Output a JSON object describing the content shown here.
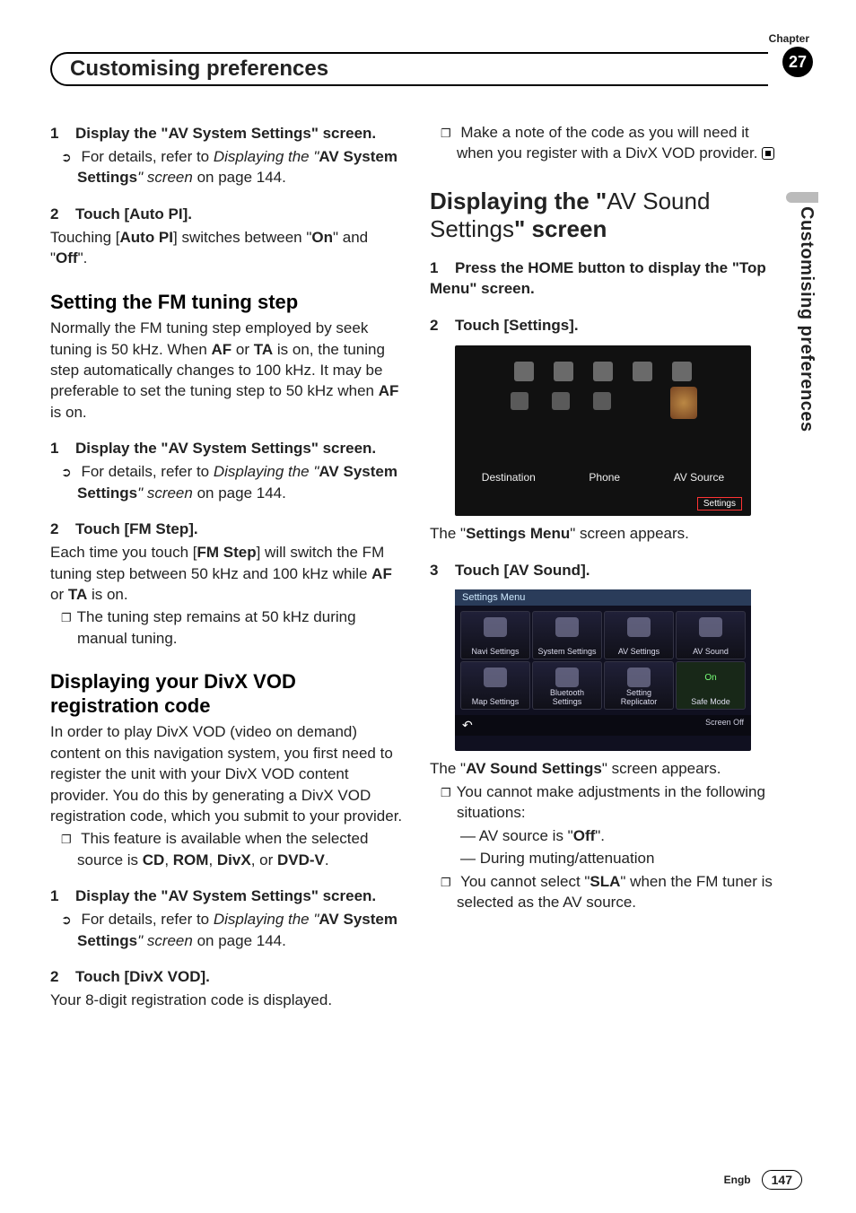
{
  "header": {
    "chapter_label": "Chapter",
    "chapter_num": "27",
    "title": "Customising preferences"
  },
  "side_tab": "Customising preferences",
  "left": {
    "s1": {
      "num": "1",
      "title": "Display the \"AV System Settings\" screen."
    },
    "s1_ref_pre": "For details, refer to ",
    "s1_ref_ital": "Displaying the \"",
    "s1_ref_bold": "AV System Settings",
    "s1_ref_post": "\" screen",
    "s1_ref_tail": " on page 144.",
    "s2": {
      "num": "2",
      "title": "Touch [Auto PI]."
    },
    "s2_body": "Touching [",
    "s2_b1": "Auto PI",
    "s2_body2": "] switches between \"",
    "s2_b2": "On",
    "s2_body3": "\" and \"",
    "s2_b3": "Off",
    "s2_body4": "\".",
    "h_fm": "Setting the FM tuning step",
    "fm_para_pre": "Normally the FM tuning step employed by seek tuning is 50 kHz. When ",
    "fm_af": "AF",
    "fm_or": " or ",
    "fm_ta": "TA",
    "fm_para_mid": " is on, the tuning step automatically changes to 100 kHz. It may be preferable to set the tuning step to 50 kHz when ",
    "fm_para_end": " is on.",
    "fm_s1": {
      "num": "1",
      "title": "Display the \"AV System Settings\" screen."
    },
    "fm_s2": {
      "num": "2",
      "title": "Touch [FM Step]."
    },
    "fm_s2_body_pre": "Each time you touch [",
    "fm_s2_b": "FM Step",
    "fm_s2_body_mid": "] will switch the FM tuning step between 50 kHz and 100 kHz while ",
    "fm_s2_body_end": " is on.",
    "fm_note": "The tuning step remains at 50 kHz during manual tuning.",
    "h_divx": "Displaying your DivX VOD registration code",
    "divx_para": "In order to play DivX VOD (video on demand) content on this navigation system, you first need to register the unit with your DivX VOD content provider. You do this by generating a DivX VOD registration code, which you submit to your provider.",
    "divx_note_pre": "This feature is available when the selected source is ",
    "divx_cd": "CD",
    "divx_c": ", ",
    "divx_rom": "ROM",
    "divx_divx": "DivX",
    "divx_or": ", or ",
    "divx_dvdv": "DVD-V",
    "divx_dot": ".",
    "dv_s1": {
      "num": "1",
      "title": "Display the \"AV System Settings\" screen."
    },
    "dv_s2": {
      "num": "2",
      "title": "Touch [DivX VOD]."
    },
    "dv_s2_body": "Your 8-digit registration code is displayed."
  },
  "right": {
    "note_top": "Make a note of the code as you will need it when you register with a DivX VOD provider.",
    "h1_pre": "Displaying the \"",
    "h1_thin": "AV Sound Settings",
    "h1_post": "\" screen",
    "s1": {
      "num": "1",
      "title": "Press the HOME button to display the \"Top Menu\" screen."
    },
    "s2": {
      "num": "2",
      "title": "Touch [Settings]."
    },
    "shot1": {
      "dest": "Destination",
      "phone": "Phone",
      "av": "AV Source",
      "settings": "Settings"
    },
    "after1_pre": "The \"",
    "after1_b": "Settings Menu",
    "after1_post": "\" screen appears.",
    "s3": {
      "num": "3",
      "title": "Touch [AV Sound]."
    },
    "shot2": {
      "title": "Settings Menu",
      "c1": "Navi Settings",
      "c2": "System Settings",
      "c3": "AV Settings",
      "c4": "AV Sound",
      "c5": "Map Settings",
      "c6": "Bluetooth Settings",
      "c7": "Setting Replicator",
      "c8": "Safe Mode",
      "soff": "Screen Off"
    },
    "after2_pre": "The \"",
    "after2_b": "AV Sound Settings",
    "after2_post": "\" screen appears.",
    "ul1": "You cannot make adjustments in the following situations:",
    "d1_pre": "AV source is \"",
    "d1_b": "Off",
    "d1_post": "\".",
    "d2": "During muting/attenuation",
    "ul2_pre": "You cannot select \"",
    "ul2_b": "SLA",
    "ul2_post": "\" when the FM tuner is selected as the AV source."
  },
  "footer": {
    "lang": "Engb",
    "page": "147"
  }
}
